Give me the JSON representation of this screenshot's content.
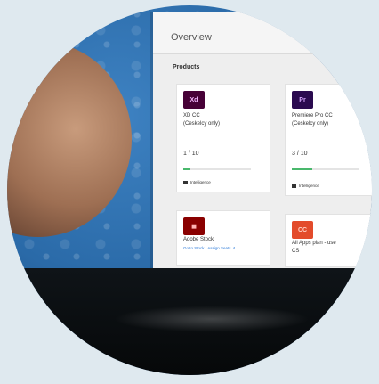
{
  "overview_title": "Overview",
  "products_label": "Products",
  "cards": [
    {
      "logo": "Xd",
      "logo_color": "#470137",
      "name": "XD CC",
      "subtitle": "(Ceskelcy only)",
      "count": "1 / 10",
      "count_caption": "",
      "progress": 0.1,
      "footer": "Intelligence"
    },
    {
      "logo": "Pr",
      "logo_color": "#2a0a4f",
      "name": "Premiere Pro CC",
      "subtitle": "(Ceskelcy only)",
      "count": "3 / 10",
      "count_caption": "",
      "progress": 0.3,
      "footer": "Intelligence"
    },
    {
      "logo": "",
      "logo_color": "#8a0000",
      "name": "Adobe Stock",
      "link": "Go to Stock · Assign Seats ↗",
      "logo_icon": "adobe-stock-icon"
    },
    {
      "logo": "CC",
      "logo_color": "#e34b2b",
      "name": "All Apps plan - use",
      "subtitle": "CS"
    }
  ]
}
